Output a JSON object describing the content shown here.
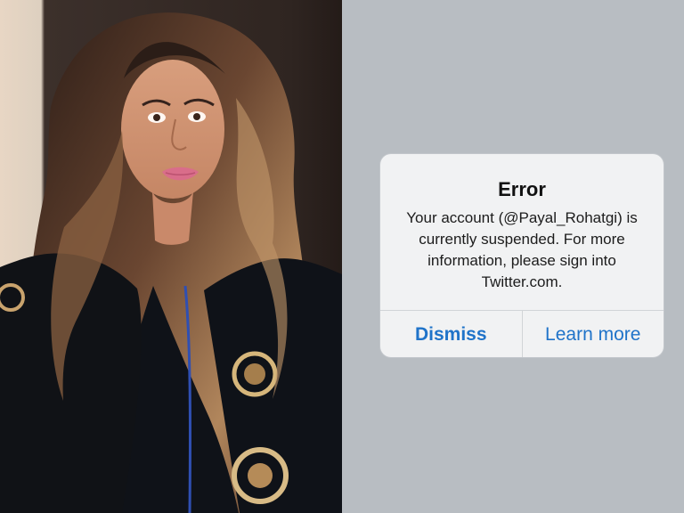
{
  "alert": {
    "title": "Error",
    "message": "Your account (@Payal_Rohatgi) is currently suspended. For more information, please sign into Twitter.com.",
    "dismiss_label": "Dismiss",
    "learn_more_label": "Learn more"
  },
  "colors": {
    "left_background": "#3b2f2a",
    "right_background": "#b8bdc2",
    "alert_background": "#f1f2f3",
    "alert_button_text": "#1f73c9"
  },
  "left_image": {
    "subject": "woman with long wavy brown hair wearing a black embroidered top"
  }
}
